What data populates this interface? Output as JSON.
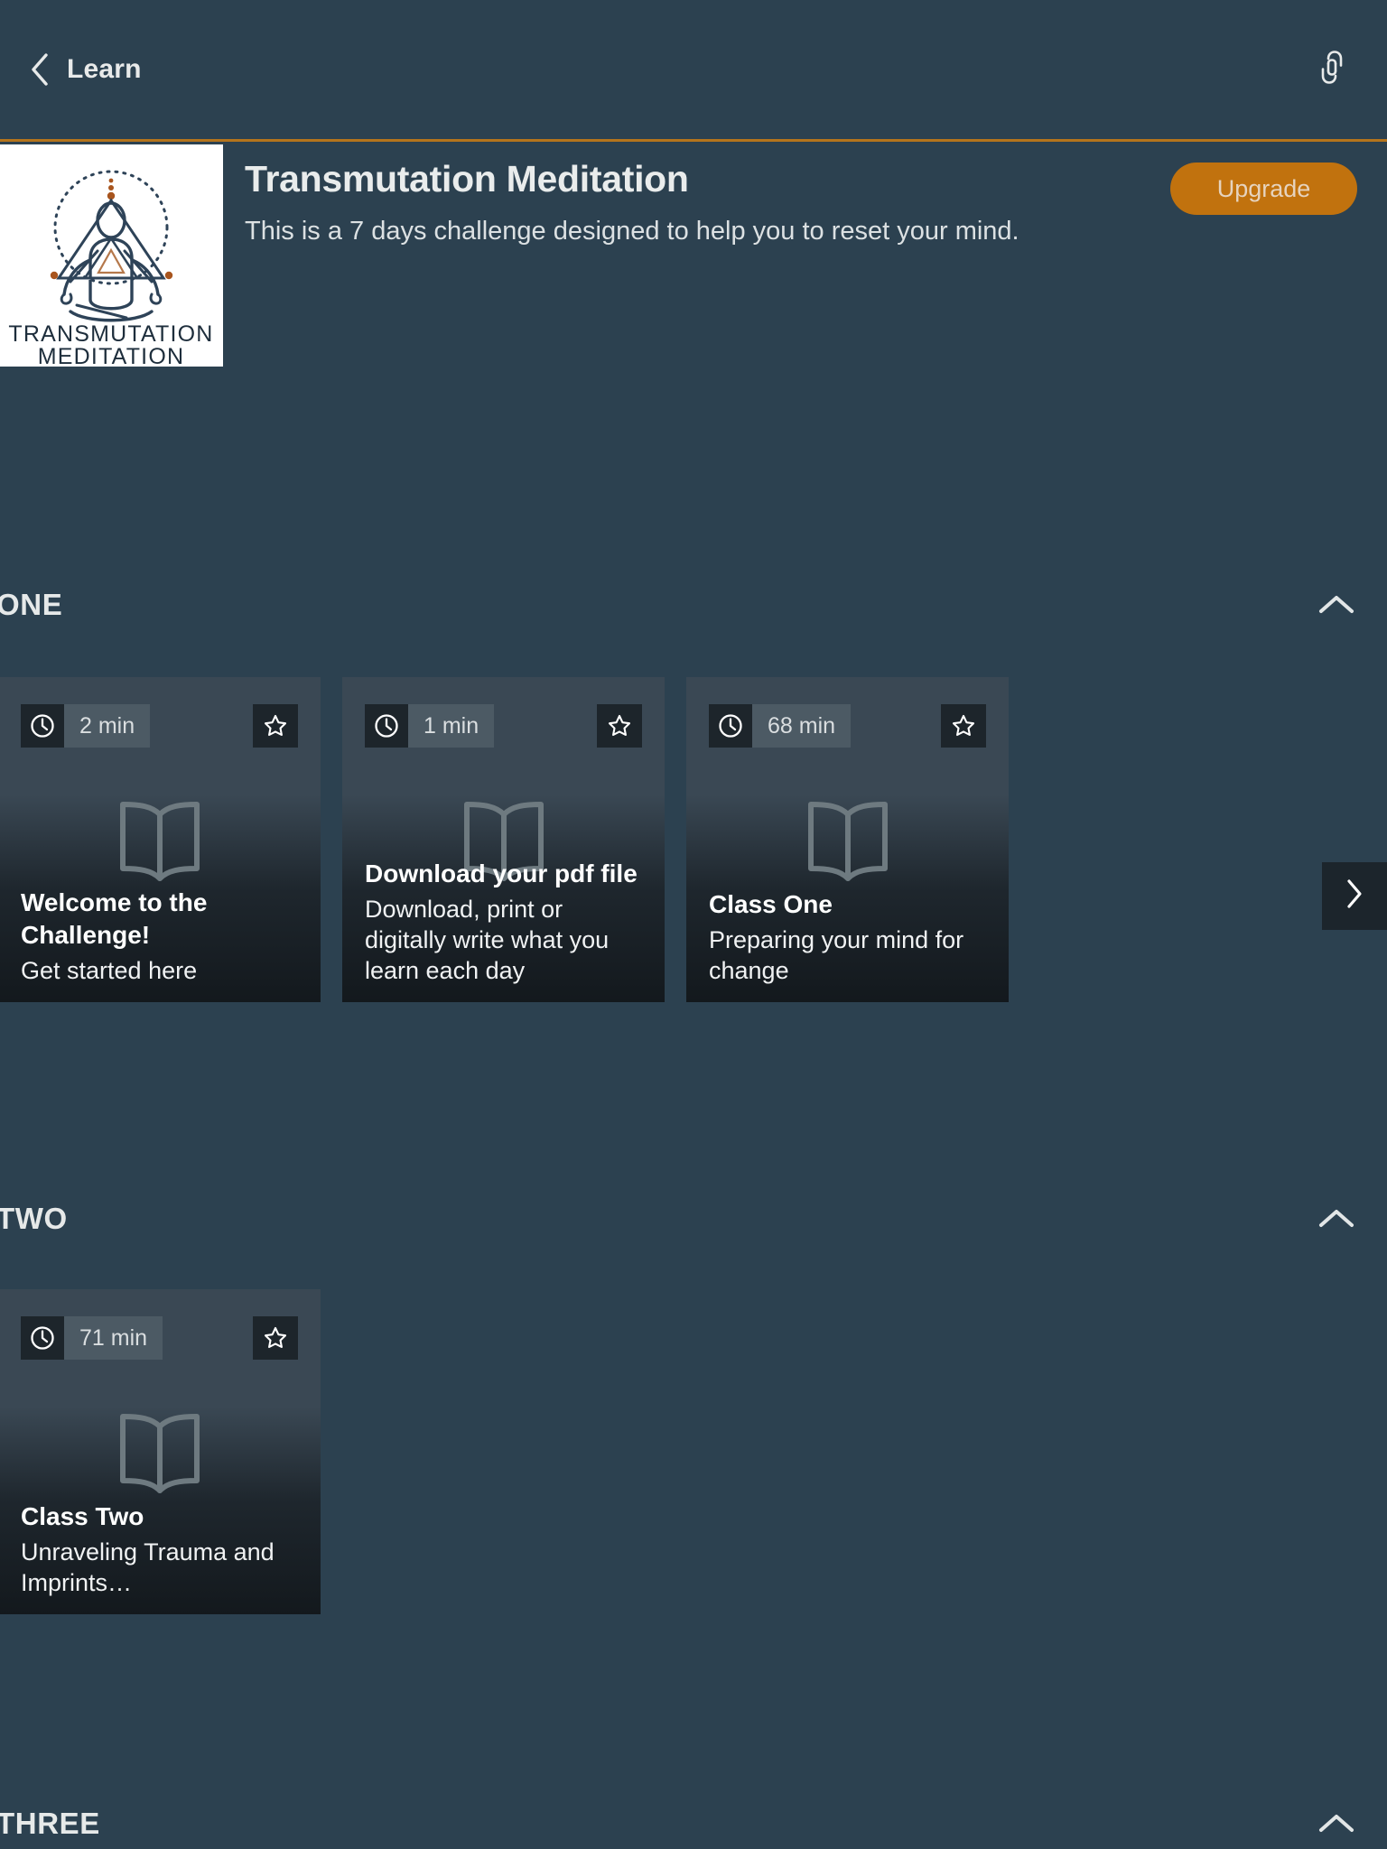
{
  "topbar": {
    "back_label": "Learn",
    "back_icon": "chevron-left-icon",
    "share_icon": "link-icon"
  },
  "course": {
    "title": "Transmutation Meditation",
    "subtitle": "This is a 7 days challenge designed to help you to reset your mind.",
    "upgrade_label": "Upgrade",
    "thumbnail_alt": "Transmutation Meditation logo",
    "thumbnail_line1": "TRANSMUTATION",
    "thumbnail_line2": "MEDITATION",
    "accent_color": "#C1720E",
    "background_color": "#2C4150"
  },
  "sections": [
    {
      "title": "ONE",
      "collapse_icon": "chevron-up-icon",
      "cards": [
        {
          "duration": "2 min",
          "clock_icon": "clock-icon",
          "star_icon": "star-outline-icon",
          "thumb_icon": "book-icon",
          "title": "Welcome to the Challenge!",
          "desc": "Get started here"
        },
        {
          "duration": "1 min",
          "clock_icon": "clock-icon",
          "star_icon": "star-outline-icon",
          "thumb_icon": "book-icon",
          "title": "Download your pdf file",
          "desc": "Download, print or digitally write what you learn each day"
        },
        {
          "duration": "68 min",
          "clock_icon": "clock-icon",
          "star_icon": "star-outline-icon",
          "thumb_icon": "book-icon",
          "title": "Class One",
          "desc": "Preparing your mind for change"
        }
      ],
      "next_icon": "chevron-right-icon"
    },
    {
      "title": "TWO",
      "collapse_icon": "chevron-up-icon",
      "cards": [
        {
          "duration": "71 min",
          "clock_icon": "clock-icon",
          "star_icon": "star-outline-icon",
          "thumb_icon": "book-icon",
          "title": "Class Two",
          "desc": "Unraveling Trauma and Imprints…"
        }
      ]
    },
    {
      "title": "THREE",
      "collapse_icon": "chevron-up-icon",
      "cards": []
    }
  ]
}
